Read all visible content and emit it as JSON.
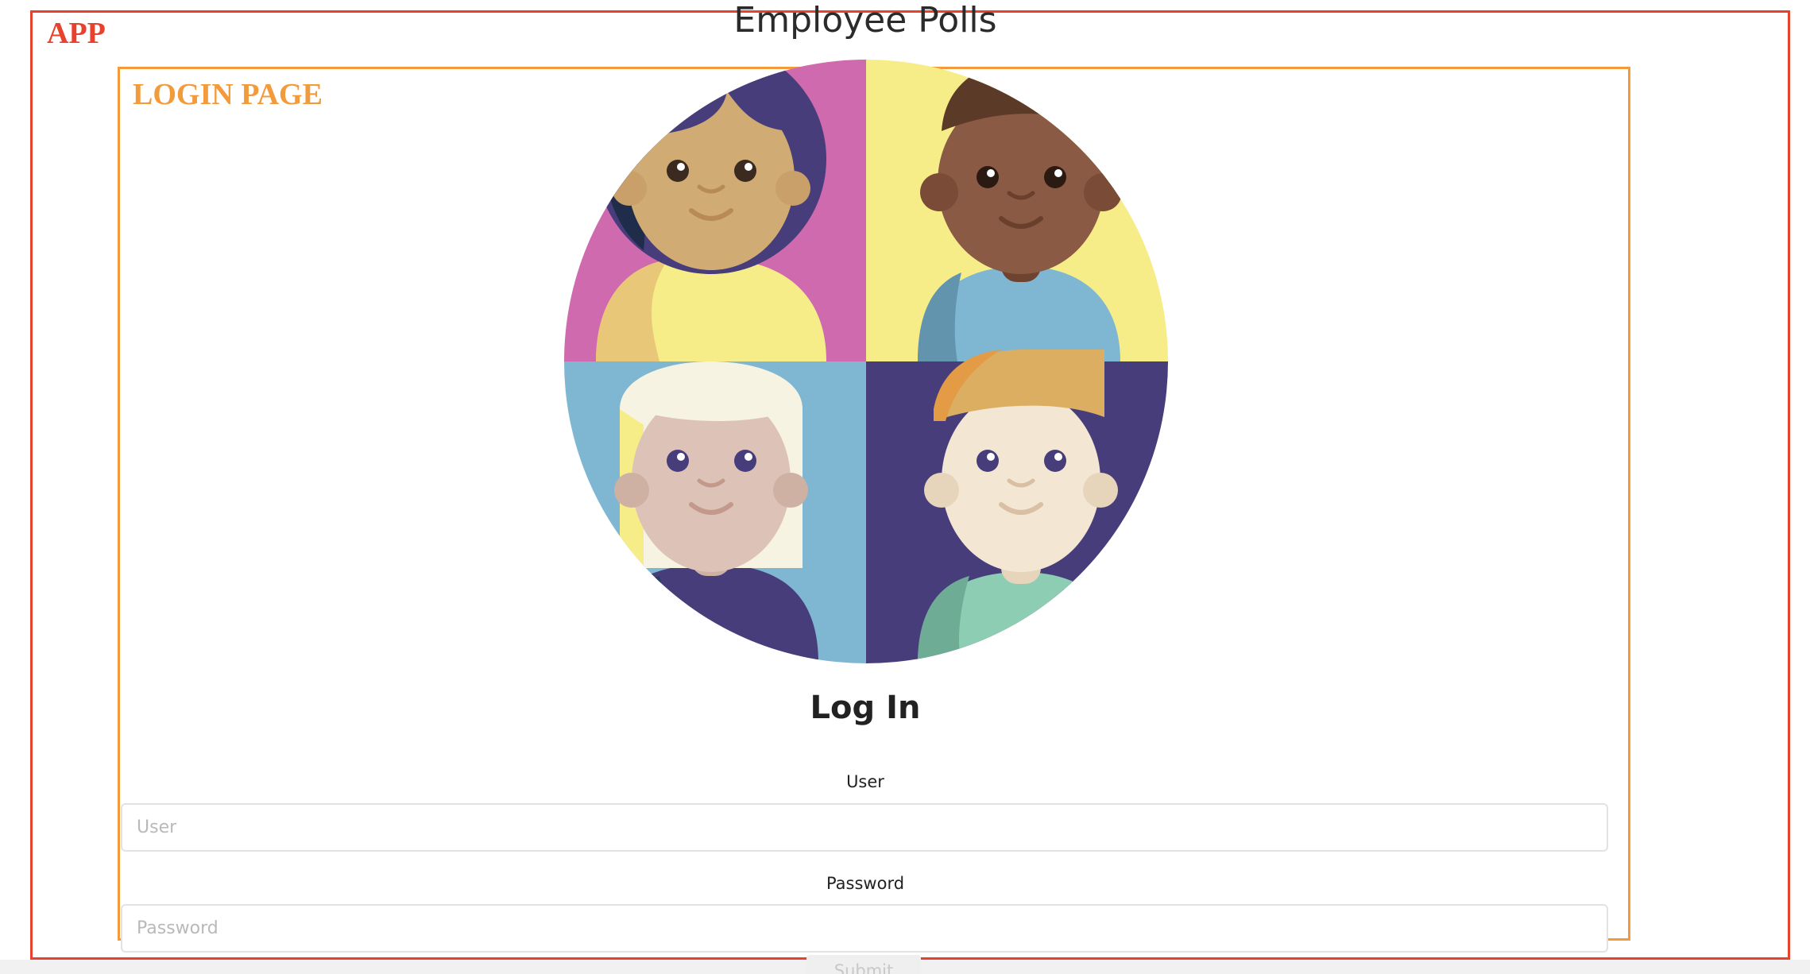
{
  "app": {
    "annotation_label": "APP",
    "title": "Employee Polls"
  },
  "login_page": {
    "annotation_label": "LOGIN PAGE",
    "heading": "Log In",
    "user_label": "User",
    "user_placeholder": "User",
    "password_label": "Password",
    "password_placeholder": "Password",
    "submit_label": "Submit"
  },
  "colors": {
    "app_outline": "#e8412e",
    "login_outline": "#f39a3a",
    "quadrant_top_left": "#d06aae",
    "quadrant_top_right": "#f6ed88",
    "quadrant_bottom_left": "#7fb6d2",
    "quadrant_bottom_right": "#473d7b"
  },
  "illustration": {
    "icon": "employee-group-icon"
  }
}
